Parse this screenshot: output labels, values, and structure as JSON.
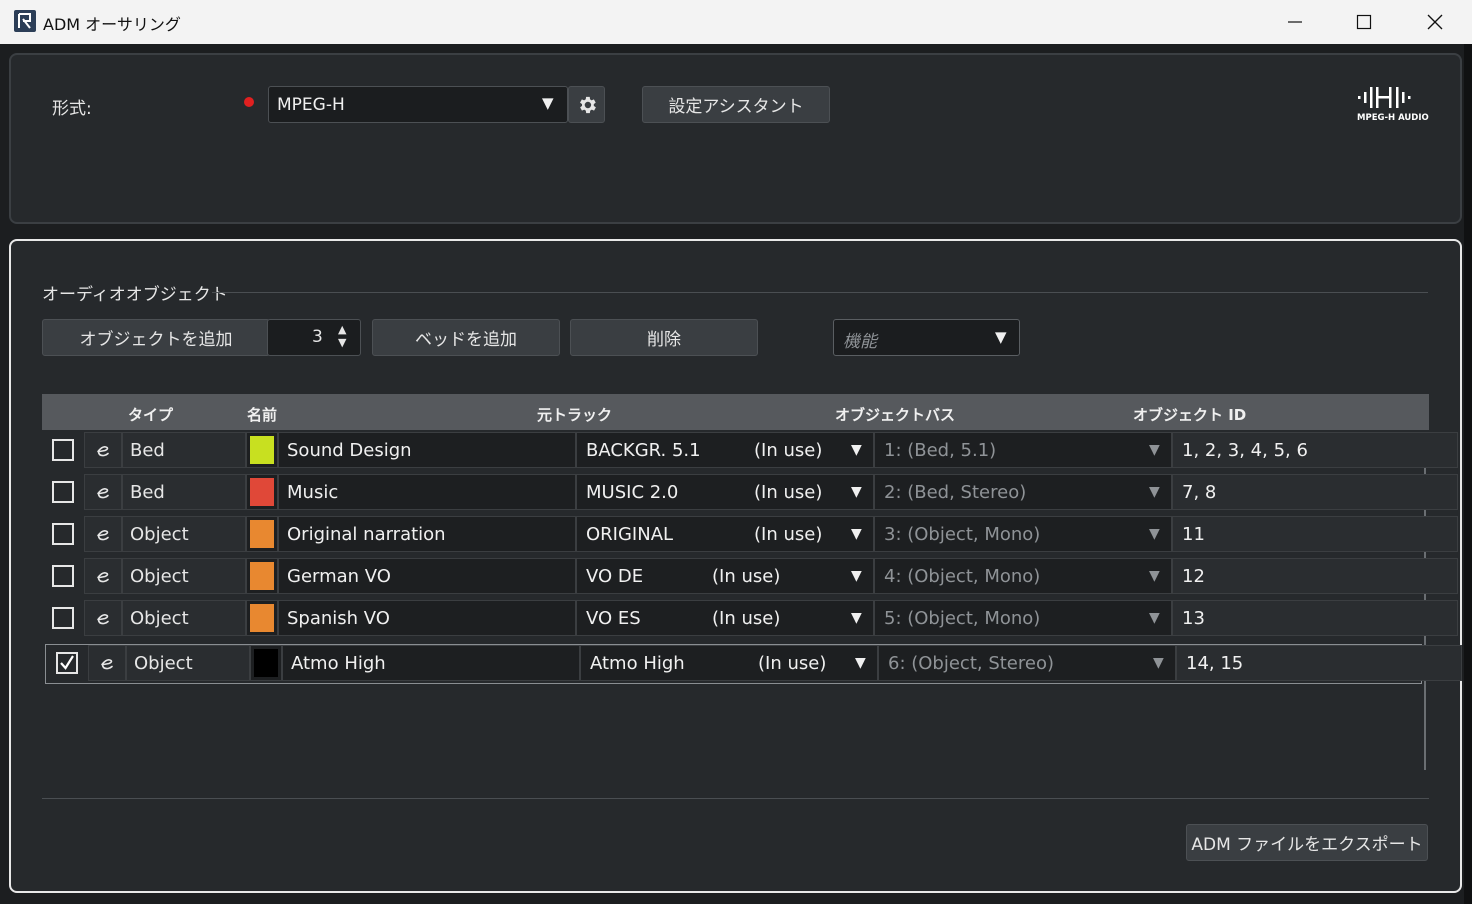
{
  "window": {
    "title": "ADM オーサリング"
  },
  "format": {
    "label": "形式:",
    "value": "MPEG-H",
    "assistant_label": "設定アシスタント",
    "logo_text": "MPEG-H AUDIO"
  },
  "objects": {
    "section_title": "オーディオオブジェクト",
    "add_object_label": "オブジェクトを追加",
    "add_count": "3",
    "add_bed_label": "ベッドを追加",
    "delete_label": "削除",
    "function_placeholder": "機能"
  },
  "table": {
    "headers": {
      "type": "タイプ",
      "name": "名前",
      "track": "元トラック",
      "bus": "オブジェクトバス",
      "ids": "オブジェクト ID"
    },
    "rows": [
      {
        "checked": false,
        "type": "Bed",
        "color": "#c8e020",
        "name": "Sound Design",
        "track": "BACKGR. 5.1",
        "status": "(In use)",
        "bus": "1: (Bed, 5.1)",
        "ids": "1, 2, 3, 4, 5, 6"
      },
      {
        "checked": false,
        "type": "Bed",
        "color": "#e04838",
        "name": "Music",
        "track": "MUSIC 2.0",
        "status": "(In use)",
        "bus": "2: (Bed, Stereo)",
        "ids": "7, 8"
      },
      {
        "checked": false,
        "type": "Object",
        "color": "#e88830",
        "name": "Original narration",
        "track": "ORIGINAL",
        "status": "(In use)",
        "bus": "3: (Object, Mono)",
        "ids": "11"
      },
      {
        "checked": false,
        "type": "Object",
        "color": "#e88830",
        "name": "German VO",
        "track": "VO DE",
        "status": "(In use)",
        "bus": "4: (Object, Mono)",
        "ids": "12"
      },
      {
        "checked": false,
        "type": "Object",
        "color": "#e88830",
        "name": "Spanish VO",
        "track": "VO ES",
        "status": "(In use)",
        "bus": "5: (Object, Mono)",
        "ids": "13"
      },
      {
        "checked": true,
        "type": "Object",
        "color": "#000000",
        "name": "Atmo High",
        "track": "Atmo High",
        "status": "(In use)",
        "bus": "6: (Object, Stereo)",
        "ids": "14, 15"
      }
    ]
  },
  "footer": {
    "export_label": "ADM ファイルをエクスポート"
  }
}
